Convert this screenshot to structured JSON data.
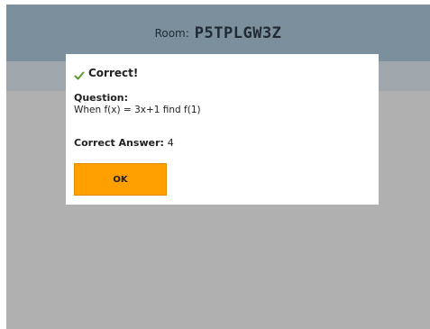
{
  "header": {
    "room_prefix": "Room:",
    "room_code": "P5TPLGW3Z"
  },
  "modal": {
    "title": "Correct!",
    "title_icon": "check-icon",
    "question_label": "Question:",
    "question_text": "When f(x) = 3x+1 find f(1)",
    "answer_label": "Correct Answer:",
    "answer_value": "4",
    "ok_label": "OK"
  },
  "colors": {
    "header_bg": "#7b8f9c",
    "subheader_bg": "#9fa7ac",
    "backdrop": "#b0b0b0",
    "check_green": "#5a9a2a",
    "ok_button": "#ff9f00"
  }
}
